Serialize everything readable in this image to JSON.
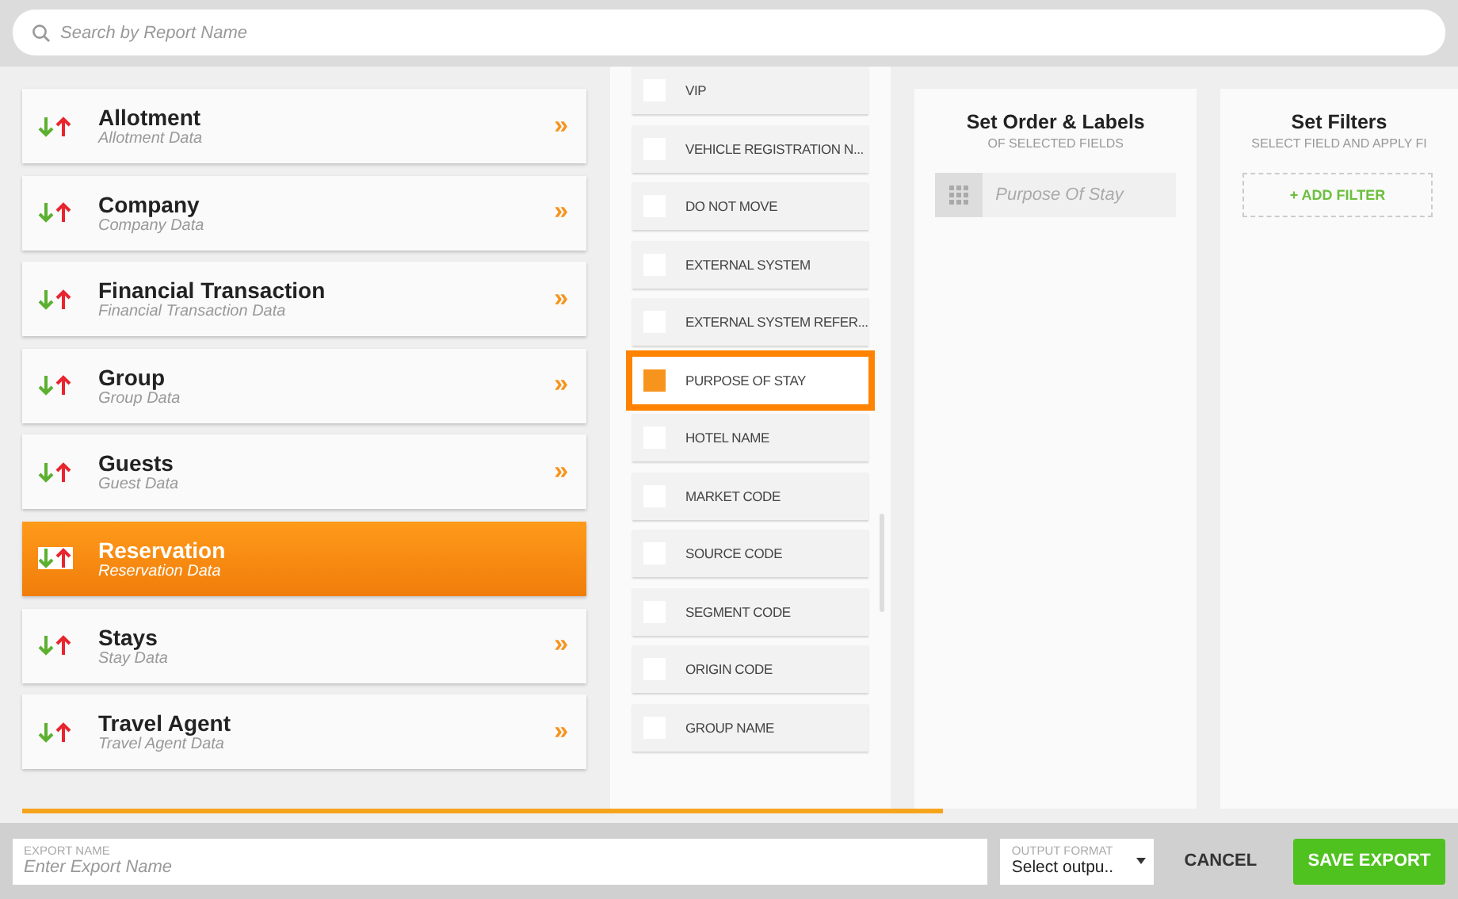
{
  "search": {
    "placeholder": "Search by Report Name"
  },
  "categories": [
    {
      "title": "Allotment",
      "subtitle": "Allotment Data",
      "selected": false
    },
    {
      "title": "Company",
      "subtitle": "Company Data",
      "selected": false
    },
    {
      "title": "Financial Transaction",
      "subtitle": "Financial Transaction Data",
      "selected": false
    },
    {
      "title": "Group",
      "subtitle": "Group Data",
      "selected": false
    },
    {
      "title": "Guests",
      "subtitle": "Guest Data",
      "selected": false
    },
    {
      "title": "Reservation",
      "subtitle": "Reservation Data",
      "selected": true
    },
    {
      "title": "Stays",
      "subtitle": "Stay Data",
      "selected": false
    },
    {
      "title": "Travel Agent",
      "subtitle": "Travel Agent Data",
      "selected": false
    }
  ],
  "chevron": "»",
  "fields": [
    {
      "label": "VIP",
      "checked": false
    },
    {
      "label": "VEHICLE REGISTRATION N...",
      "checked": false
    },
    {
      "label": "DO NOT MOVE",
      "checked": false
    },
    {
      "label": "EXTERNAL SYSTEM",
      "checked": false
    },
    {
      "label": "EXTERNAL SYSTEM REFER...",
      "checked": false
    },
    {
      "label": "PURPOSE OF STAY",
      "checked": true
    },
    {
      "label": "HOTEL NAME",
      "checked": false
    },
    {
      "label": "MARKET CODE",
      "checked": false
    },
    {
      "label": "SOURCE CODE",
      "checked": false
    },
    {
      "label": "SEGMENT CODE",
      "checked": false
    },
    {
      "label": "ORIGIN CODE",
      "checked": false
    },
    {
      "label": "GROUP NAME",
      "checked": false
    }
  ],
  "order_panel": {
    "title": "Set Order & Labels",
    "subtitle": "OF SELECTED FIELDS",
    "items": [
      "Purpose Of Stay"
    ]
  },
  "filters_panel": {
    "title": "Set Filters",
    "subtitle": "SELECT FIELD AND APPLY FI",
    "add_button": "+ ADD FILTER"
  },
  "footer": {
    "export_name": {
      "label": "EXPORT NAME",
      "placeholder": "Enter Export Name"
    },
    "output_format": {
      "label": "OUTPUT FORMAT",
      "value": "Select outpu.."
    },
    "cancel": "CANCEL",
    "save": "SAVE EXPORT"
  }
}
